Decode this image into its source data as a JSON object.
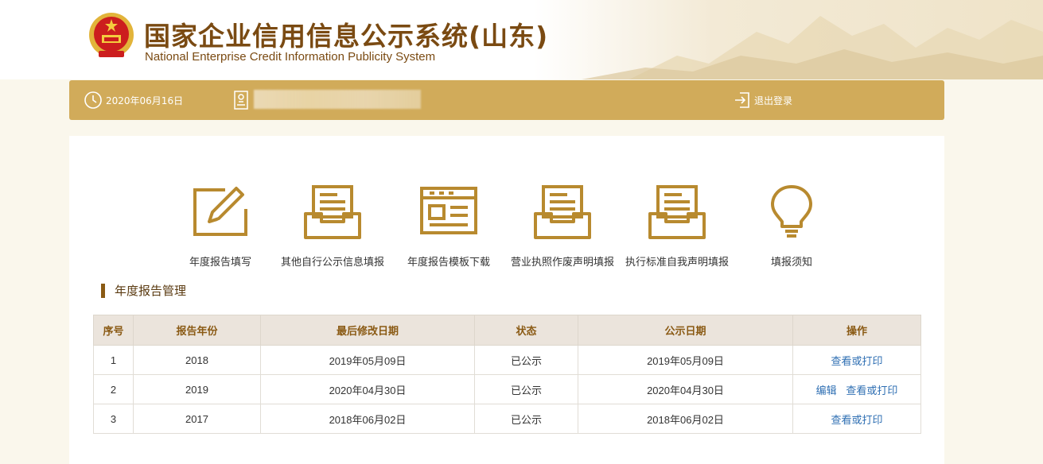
{
  "header": {
    "title": "国家企业信用信息公示系统(山东)",
    "subtitle": "National Enterprise Credit Information Publicity System"
  },
  "info_bar": {
    "date": "2020年06月16日",
    "logout_label": "退出登录"
  },
  "shortcuts": [
    {
      "label": "年度报告填写",
      "icon": "pencil-edit-icon"
    },
    {
      "label": "其他自行公示信息填报",
      "icon": "inbox-tray-icon"
    },
    {
      "label": "年度报告模板下载",
      "icon": "template-window-icon"
    },
    {
      "label": "营业执照作废声明填报",
      "icon": "inbox-tray-icon"
    },
    {
      "label": "执行标准自我声明填报",
      "icon": "inbox-tray-icon"
    },
    {
      "label": "填报须知",
      "icon": "lightbulb-icon"
    }
  ],
  "section_title": "年度报告管理",
  "table": {
    "headers": [
      "序号",
      "报告年份",
      "最后修改日期",
      "状态",
      "公示日期",
      "操作"
    ],
    "rows": [
      {
        "index": "1",
        "year": "2018",
        "modified": "2019年05月09日",
        "status": "已公示",
        "published": "2019年05月09日",
        "actions": [
          "查看或打印"
        ]
      },
      {
        "index": "2",
        "year": "2019",
        "modified": "2020年04月30日",
        "status": "已公示",
        "published": "2020年04月30日",
        "actions": [
          "编辑",
          "查看或打印"
        ]
      },
      {
        "index": "3",
        "year": "2017",
        "modified": "2018年06月02日",
        "status": "已公示",
        "published": "2018年06月02日",
        "actions": [
          "查看或打印"
        ]
      }
    ]
  },
  "colors": {
    "gold": "#d1ab5a",
    "brown": "#7a4a12",
    "icon": "#b88a2f",
    "link": "#2f6fb3"
  }
}
